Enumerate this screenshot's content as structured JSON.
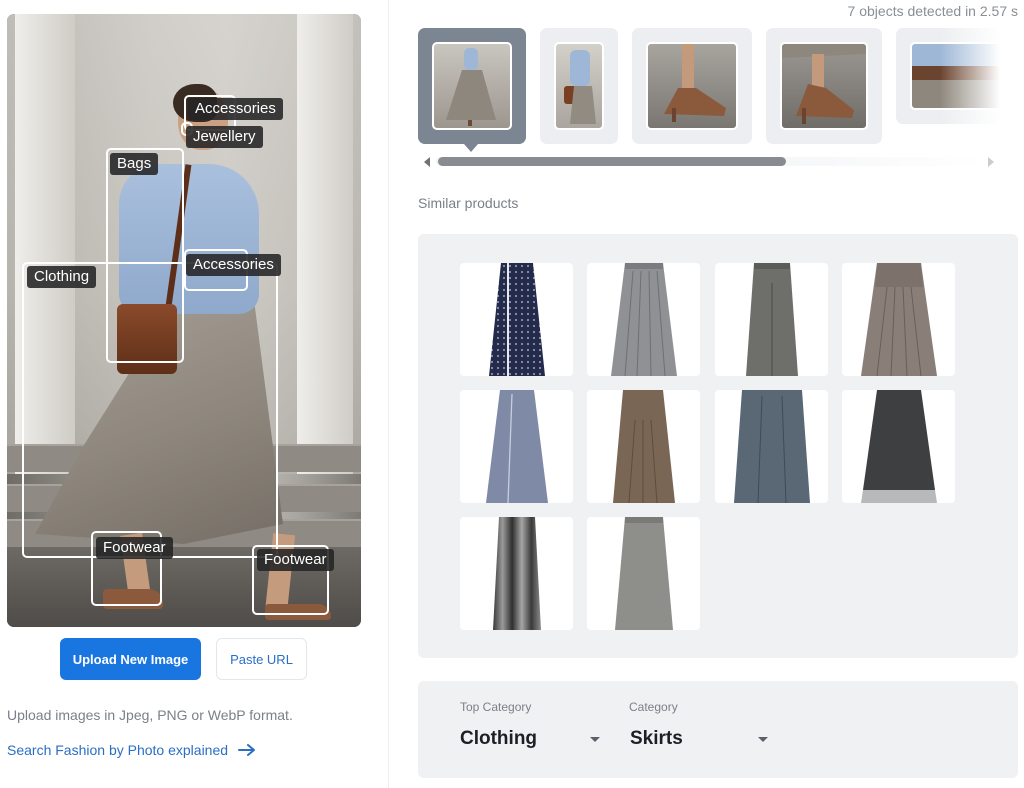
{
  "detection": {
    "summary": "7 objects detected in 2.57 s",
    "labels": [
      "Accessories",
      "Jewellery",
      "Bags",
      "Clothing",
      "Accessories",
      "Footwear",
      "Footwear"
    ]
  },
  "left": {
    "upload_button": "Upload New Image",
    "paste_button": "Paste URL",
    "hint": "Upload images in Jpeg, PNG or WebP format.",
    "explain_link": "Search Fashion by Photo explained",
    "explain_icon": "arrow-right-icon"
  },
  "similar": {
    "title": "Similar products",
    "item_count": 10
  },
  "filters": {
    "top_category_label": "Top Category",
    "top_category_value": "Clothing",
    "category_label": "Category",
    "category_value": "Skirts"
  },
  "colors": {
    "accent": "#1976e1",
    "link": "#2a6fc6",
    "panel": "#f0f1f3",
    "active_thumb": "#7c8592"
  }
}
